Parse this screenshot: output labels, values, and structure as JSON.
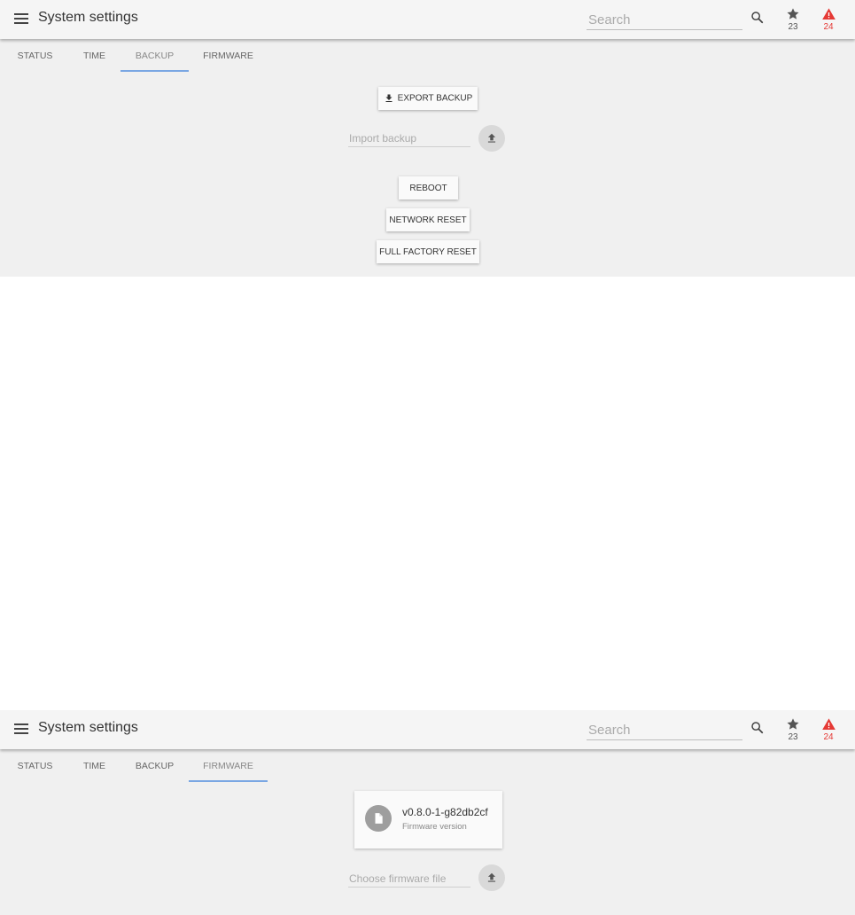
{
  "screens": [
    {
      "appbar": {
        "title": "System settings",
        "search_placeholder": "Search",
        "favorites_count": "23",
        "alerts_count": "24"
      },
      "tabs": [
        {
          "label": "Status",
          "active": false
        },
        {
          "label": "Time",
          "active": false
        },
        {
          "label": "Backup",
          "active": true
        },
        {
          "label": "Firmware",
          "active": false
        }
      ],
      "backup": {
        "export_label": "Export backup",
        "import_placeholder": "Import backup",
        "reboot_label": "Reboot",
        "network_reset_label": "Network reset",
        "factory_reset_label": "Full factory reset"
      }
    },
    {
      "appbar": {
        "title": "System settings",
        "search_placeholder": "Search",
        "favorites_count": "23",
        "alerts_count": "24"
      },
      "tabs": [
        {
          "label": "Status",
          "active": false
        },
        {
          "label": "Time",
          "active": false
        },
        {
          "label": "Backup",
          "active": false
        },
        {
          "label": "Firmware",
          "active": true
        }
      ],
      "firmware": {
        "version": "v0.8.0-1-g82db2cf",
        "version_label": "Firmware version",
        "file_placeholder": "Choose firmware file"
      }
    }
  ],
  "icons": {
    "menu": "menu-icon",
    "search": "search-icon",
    "favorites": "star-icon",
    "alerts": "warning-icon",
    "export": "download-icon",
    "upload": "upload-icon",
    "file": "file-icon"
  },
  "colors": {
    "alert": "#e53935",
    "tab_indicator": "#7aa7e3",
    "background": "#f0f0f0"
  }
}
